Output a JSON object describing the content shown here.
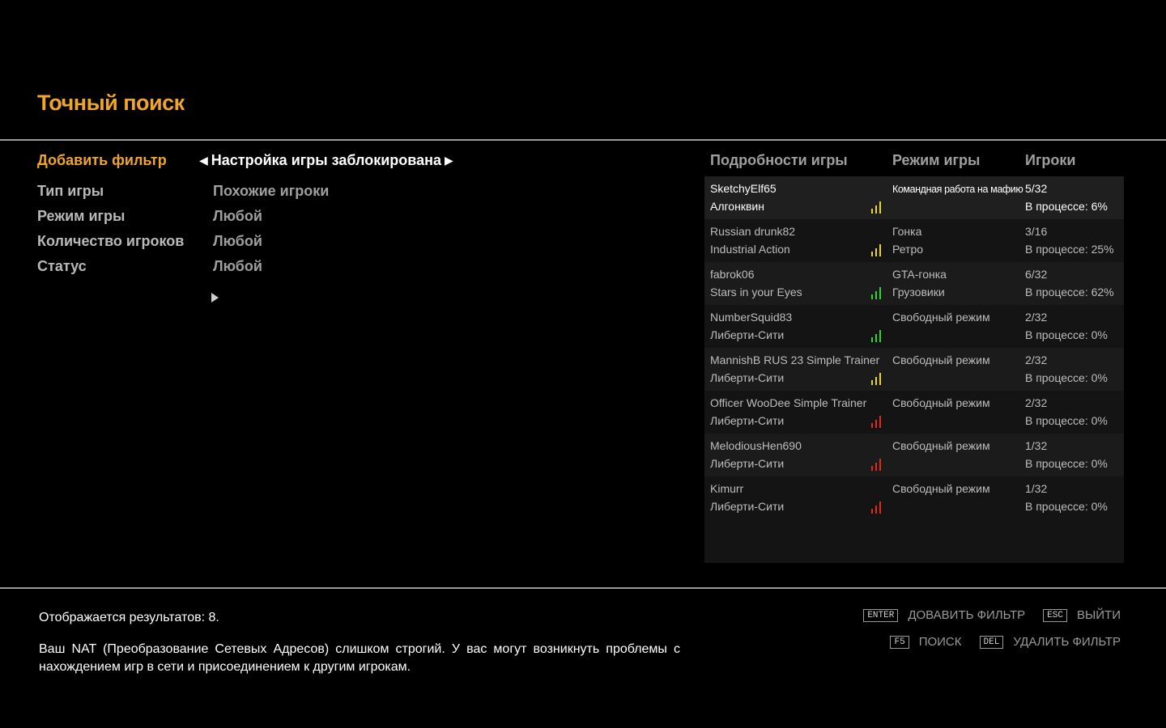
{
  "title": "Точный поиск",
  "filters": {
    "add_label": "Добавить фильтр",
    "selector_value": "Настройка игры заблокирована",
    "rows": [
      {
        "label": "Тип игры",
        "value": "Похожие игроки"
      },
      {
        "label": "Режим игры",
        "value": "Любой"
      },
      {
        "label": "Количество игроков",
        "value": "Любой"
      },
      {
        "label": "Статус",
        "value": "Любой"
      }
    ]
  },
  "table": {
    "headers": {
      "details": "Подробности игры",
      "mode": "Режим игры",
      "players": "Игроки"
    },
    "rows": [
      {
        "host": "SketchyElf65",
        "map": "Алгонквин",
        "mode": "Командная работа на мафию",
        "sub": "",
        "players": "5/32",
        "progress": "В процессе: 6%",
        "signal": "yellow",
        "signal_color": "#e8d62a"
      },
      {
        "host": "Russian drunk82",
        "map": "Industrial Action",
        "mode": "Гонка",
        "sub": "Ретро",
        "players": "3/16",
        "progress": "В процессе: 25%",
        "signal": "yellow",
        "signal_color": "#e8d62a"
      },
      {
        "host": "fabrok06",
        "map": "Stars in your Eyes",
        "mode": "GTA-гонка",
        "sub": "Грузовики",
        "players": "6/32",
        "progress": "В процессе: 62%",
        "signal": "green",
        "signal_color": "#2fd62f"
      },
      {
        "host": "NumberSquid83",
        "map": "Либерти-Сити",
        "mode": "Свободный режим",
        "sub": "",
        "players": "2/32",
        "progress": "В процессе: 0%",
        "signal": "green",
        "signal_color": "#2fd62f"
      },
      {
        "host": "MannishB RUS 23 Simple Trainer",
        "map": "Либерти-Сити",
        "mode": "Свободный режим",
        "sub": "",
        "players": "2/32",
        "progress": "В процессе: 0%",
        "signal": "yellow",
        "signal_color": "#e8d62a"
      },
      {
        "host": "Officer WooDee Simple Trainer",
        "map": "Либерти-Сити",
        "mode": "Свободный режим",
        "sub": "",
        "players": "2/32",
        "progress": "В процессе: 0%",
        "signal": "red",
        "signal_color": "#e02a1a"
      },
      {
        "host": "MelodiousHen690",
        "map": "Либерти-Сити",
        "mode": "Свободный режим",
        "sub": "",
        "players": "1/32",
        "progress": "В процессе: 0%",
        "signal": "red",
        "signal_color": "#e02a1a"
      },
      {
        "host": "Kimurr",
        "map": "Либерти-Сити",
        "mode": "Свободный режим",
        "sub": "",
        "players": "1/32",
        "progress": "В процессе: 0%",
        "signal": "red",
        "signal_color": "#e02a1a"
      }
    ]
  },
  "footer": {
    "results": "Отображается результатов: 8.",
    "nat_warning": "Ваш NAT (Преобразование Сетевых Адресов) слишком строгий. У вас могут возникнуть проблемы с нахождением игр в сети и присоединением к другим игрокам.",
    "hints": [
      {
        "key": "ENTER",
        "label": "ДОВАВИТЬ ФИЛЬТР"
      },
      {
        "key": "ESC",
        "label": "ВЫЙТИ"
      },
      {
        "key": "F5",
        "label": "ПОИСК"
      },
      {
        "key": "DEL",
        "label": "УДАЛИТЬ ФИЛЬТР"
      }
    ]
  },
  "colors": {
    "accent": "#f0a52c",
    "background": "#000000"
  }
}
